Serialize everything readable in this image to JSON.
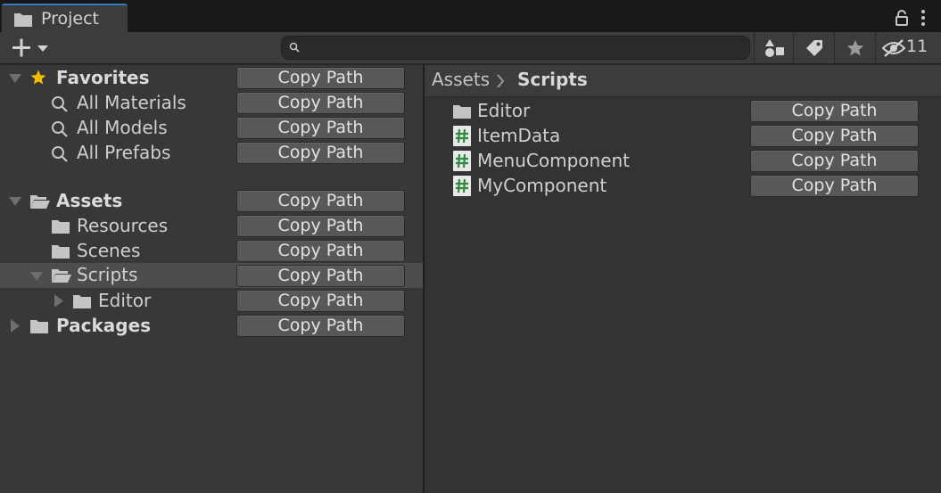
{
  "window": {
    "tab_title": "Project",
    "filter_hidden_count": "11"
  },
  "toolbar": {
    "search_value": "",
    "search_placeholder": ""
  },
  "copy_label": "Copy Path",
  "tree": [
    {
      "label": "Favorites",
      "bold": true,
      "icon": "star-icon"
    },
    {
      "label": "All Materials",
      "bold": false,
      "icon": "search-icon"
    },
    {
      "label": "All Models",
      "bold": false,
      "icon": "search-icon"
    },
    {
      "label": "All Prefabs",
      "bold": false,
      "icon": "search-icon"
    },
    {
      "label": "Assets",
      "bold": true,
      "icon": "folder-open-icon"
    },
    {
      "label": "Resources",
      "bold": false,
      "icon": "folder-icon"
    },
    {
      "label": "Scenes",
      "bold": false,
      "icon": "folder-icon"
    },
    {
      "label": "Scripts",
      "bold": false,
      "icon": "folder-open-icon",
      "selected": true
    },
    {
      "label": "Editor",
      "bold": false,
      "icon": "folder-icon"
    },
    {
      "label": "Packages",
      "bold": true,
      "icon": "folder-icon"
    }
  ],
  "breadcrumb": {
    "root": "Assets",
    "current": "Scripts"
  },
  "files": [
    {
      "label": "Editor",
      "icon": "folder-icon"
    },
    {
      "label": "ItemData",
      "icon": "csharp-script-icon"
    },
    {
      "label": "MenuComponent",
      "icon": "csharp-script-icon"
    },
    {
      "label": "MyComponent",
      "icon": "csharp-script-icon"
    }
  ],
  "colors": {
    "accent": "#3a79bb",
    "star": "#f4bc02",
    "script_icon": "#2d8a3e"
  }
}
